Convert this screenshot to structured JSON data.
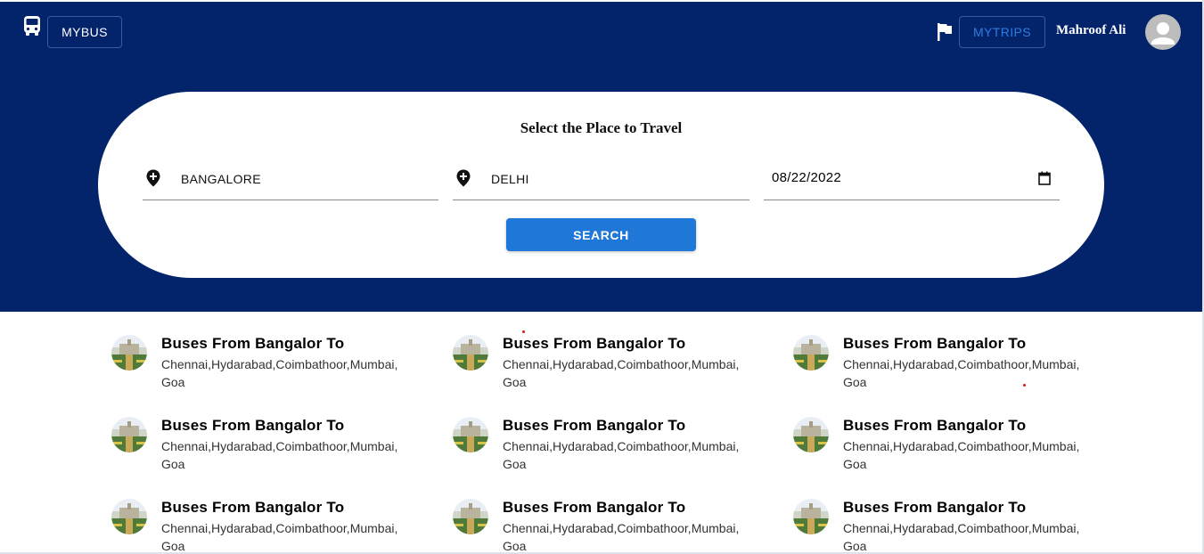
{
  "nav": {
    "brand_label": "MYBUS",
    "mytrips_label": "MYTRIPS",
    "user_name": "Mahroof Ali"
  },
  "search": {
    "title": "Select the Place to Travel",
    "from_value": "BANGALORE",
    "to_value": "DELHI",
    "date_value": "08/22/2022",
    "button_label": "SEARCH"
  },
  "routes": [
    {
      "title": "Buses From Bangalor To",
      "desc": "Chennai,Hydarabad,Coimbathoor,Mumbai, Goa"
    },
    {
      "title": "Buses From Bangalor To",
      "desc": "Chennai,Hydarabad,Coimbathoor,Mumbai, Goa"
    },
    {
      "title": "Buses From Bangalor To",
      "desc": "Chennai,Hydarabad,Coimbathoor,Mumbai, Goa"
    },
    {
      "title": "Buses From Bangalor To",
      "desc": "Chennai,Hydarabad,Coimbathoor,Mumbai, Goa"
    },
    {
      "title": "Buses From Bangalor To",
      "desc": "Chennai,Hydarabad,Coimbathoor,Mumbai, Goa"
    },
    {
      "title": "Buses From Bangalor To",
      "desc": "Chennai,Hydarabad,Coimbathoor,Mumbai, Goa"
    },
    {
      "title": "Buses From Bangalor To",
      "desc": "Chennai,Hydarabad,Coimbathoor,Mumbai, Goa"
    },
    {
      "title": "Buses From Bangalor To",
      "desc": "Chennai,Hydarabad,Coimbathoor,Mumbai, Goa"
    },
    {
      "title": "Buses From Bangalor To",
      "desc": "Chennai,Hydarabad,Coimbathoor,Mumbai, Goa"
    }
  ],
  "colors": {
    "header_bg": "#03236b",
    "primary": "#1f78d8",
    "mytrips_text": "#2f7de1"
  },
  "icons": {
    "brand": "bus-icon",
    "trips": "flag-icon",
    "user": "avatar-icon",
    "location": "add-location-icon",
    "date": "calendar-icon"
  }
}
